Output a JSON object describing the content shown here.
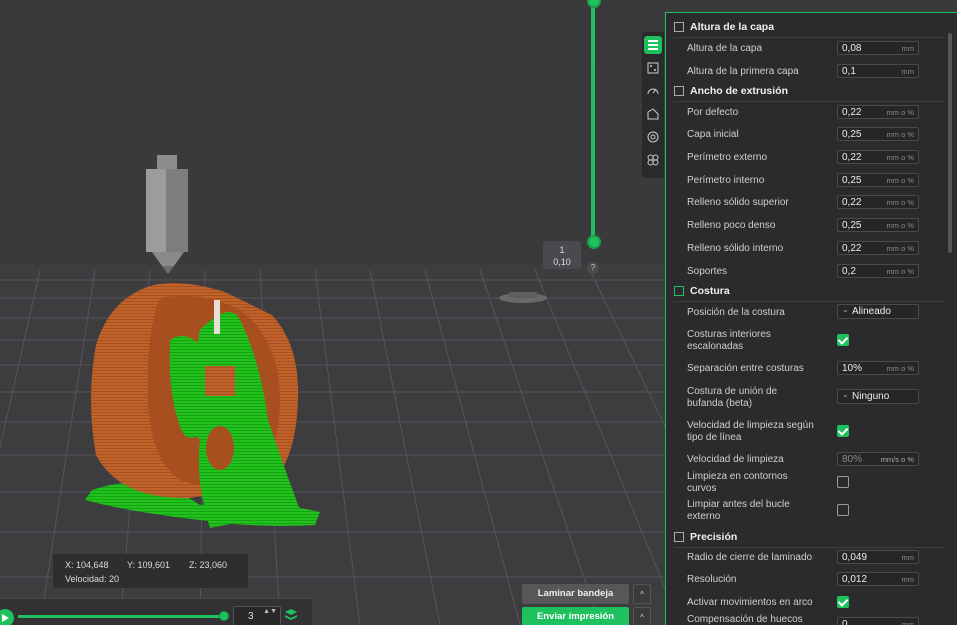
{
  "layer_tooltip": {
    "layer": "1",
    "height": "0,10"
  },
  "help_mark": "?",
  "coords": {
    "x": "X: 104,648",
    "y": "Y: 109,601",
    "z": "Z: 23,060",
    "speed_label": "Velocidad:",
    "speed_value": "20"
  },
  "bottom": {
    "spinner_value": "3",
    "spinner_arrows": "▲▼"
  },
  "buttons": {
    "slice": "Laminar bandeja",
    "send": "Enviar impresión",
    "caret": "^"
  },
  "colors": {
    "accent": "#1fc15f",
    "model_orange": "#c0622a",
    "support_green": "#22c21c"
  },
  "panel": {
    "layer_height": {
      "title": "Altura de la capa",
      "rows": [
        {
          "label": "Altura de la capa",
          "value": "0,08",
          "unit": "mm"
        },
        {
          "label": "Altura de la primera capa",
          "value": "0,1",
          "unit": "mm"
        }
      ]
    },
    "extrusion_width": {
      "title": "Ancho de extrusión",
      "rows": [
        {
          "label": "Por defecto",
          "value": "0,22",
          "unit": "mm o %"
        },
        {
          "label": "Capa inicial",
          "value": "0,25",
          "unit": "mm o %"
        },
        {
          "label": "Perímetro externo",
          "value": "0,22",
          "unit": "mm o %"
        },
        {
          "label": "Perímetro interno",
          "value": "0,25",
          "unit": "mm o %"
        },
        {
          "label": "Relleno sólido superior",
          "value": "0,22",
          "unit": "mm o %"
        },
        {
          "label": "Relleno poco denso",
          "value": "0,25",
          "unit": "mm o %"
        },
        {
          "label": "Relleno sólido interno",
          "value": "0,22",
          "unit": "mm o %"
        },
        {
          "label": "Soportes",
          "value": "0,2",
          "unit": "mm o %"
        }
      ]
    },
    "seam": {
      "title": "Costura",
      "position_label": "Posición de la costura",
      "position_value": "Alineado",
      "staggered_label_1": "Costuras interiores",
      "staggered_label_2": "escalonadas",
      "gap_label": "Separación entre costuras",
      "gap_value": "10%",
      "gap_unit": "mm o %",
      "scarf_label_1": "Costura de unión de",
      "scarf_label_2": "bufanda (beta)",
      "scarf_value": "Ninguno",
      "wipe_speed_type_label_1": "Velocidad de limpieza según",
      "wipe_speed_type_label_2": "tipo de línea",
      "wipe_speed_label": "Velocidad de limpieza",
      "wipe_speed_value": "80%",
      "wipe_speed_unit": "mm/s o %",
      "wipe_curved_label_1": "Limpieza en contornos",
      "wipe_curved_label_2": "curvos",
      "wipe_before_label_1": "Limpiar antes del bucle",
      "wipe_before_label_2": "externo"
    },
    "precision": {
      "title": "Precisión",
      "slice_closing_label": "Radio de cierre de laminado",
      "slice_closing_value": "0,049",
      "resolution_label": "Resolución",
      "resolution_value": "0,012",
      "arc_label": "Activar movimientos en arco",
      "hole_comp_label": "Compensación de huecos",
      "hole_comp_value": "0",
      "unit": "mm"
    }
  }
}
